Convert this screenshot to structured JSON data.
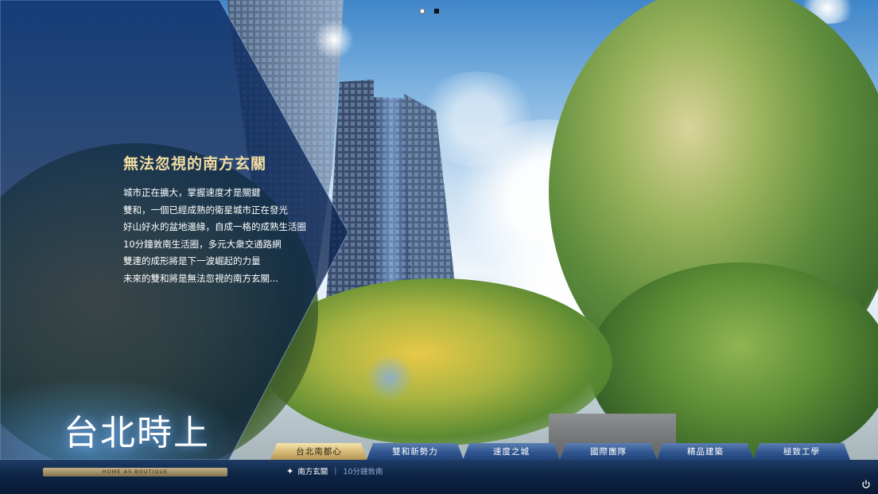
{
  "hero": {
    "title": "無法忽視的南方玄關",
    "lines": [
      "城市正在擴大，掌握速度才是關鍵",
      "雙和，一個已經成熟的衛星城市正在發光",
      "好山好水的盆地邊緣，自成一格的成熟生活圈",
      "10分鐘敦南生活圈，多元大衆交通路網",
      "雙連的成形將是下一波崛起的力量",
      "未來的雙和將是無法忽視的南方玄關..."
    ]
  },
  "pager": {
    "total": 2,
    "active_index": 1
  },
  "brand": {
    "name": "台北時上",
    "tagline": "HOME AS BOUTIQUE"
  },
  "tabs": [
    {
      "label": "台北南都心",
      "active": true
    },
    {
      "label": "雙和新勢力",
      "active": false
    },
    {
      "label": "速度之城",
      "active": false
    },
    {
      "label": "國際團隊",
      "active": false
    },
    {
      "label": "精品建築",
      "active": false
    },
    {
      "label": "極致工學",
      "active": false
    }
  ],
  "subnav": {
    "current": "南方玄關",
    "separator": "|",
    "other": "10分鐘敦南"
  },
  "icons": {
    "power": "power-icon",
    "subnav_marker": "sparkle-icon"
  },
  "colors": {
    "accent_gold": "#d4b874",
    "nav_blue": "#30558f",
    "title_gold": "#f1dca2"
  }
}
